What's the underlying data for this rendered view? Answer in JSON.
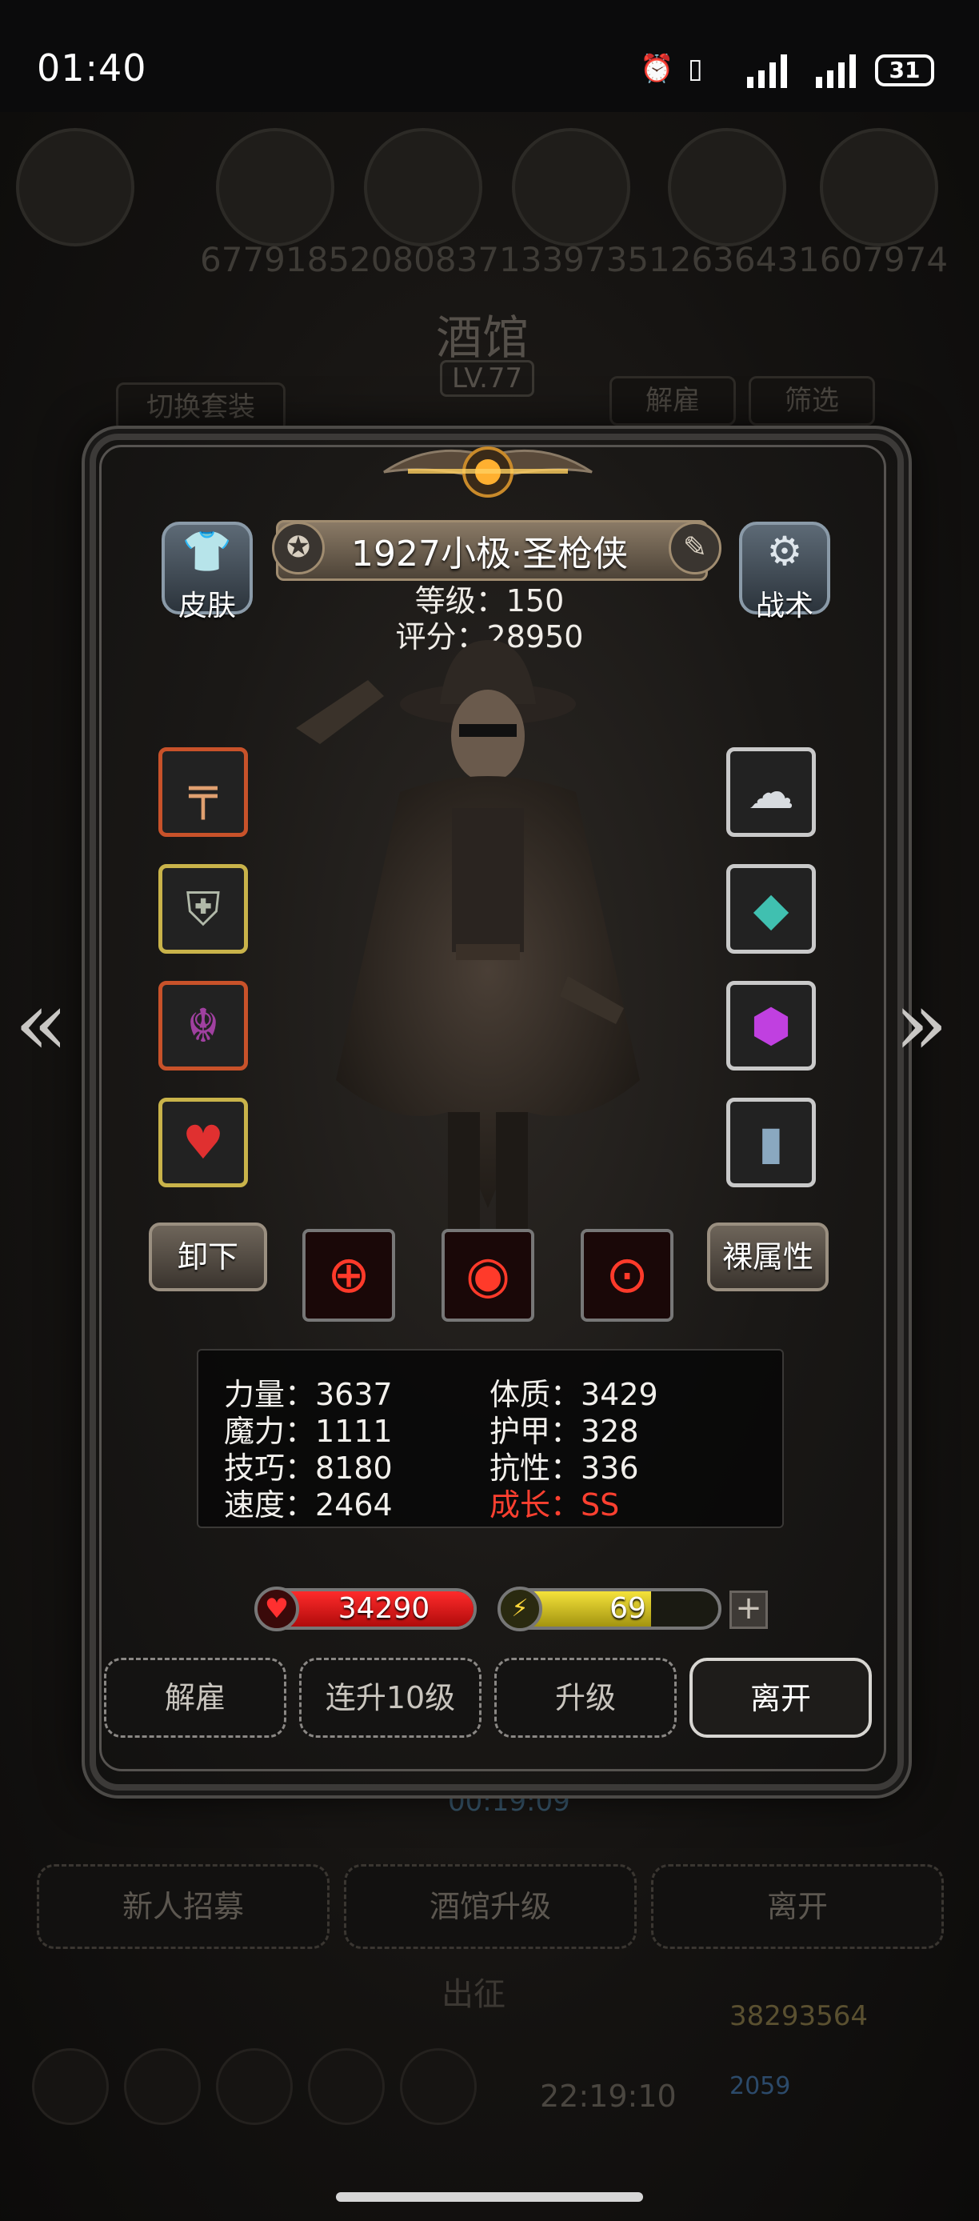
{
  "status_bar": {
    "time": "01:40",
    "battery": "31",
    "icons": [
      "alarm-icon",
      "vibrate-icon",
      "signal-icon",
      "signal-icon"
    ]
  },
  "background": {
    "resources": [
      "6779185",
      "2080837",
      "1339735",
      "1263643",
      "1607974"
    ],
    "title": "酒馆",
    "level": "LV.77",
    "switch_set_label": "切换套装",
    "dismiss_label": "解雇",
    "filter_label": "筛选",
    "timer": "00:19:09",
    "recruit_label": "新人招募",
    "upgrade_tavern_label": "酒馆升级",
    "leave_label": "离开",
    "expedition_label": "出征",
    "gold": "38293564",
    "gems": "2059",
    "time2": "22:19:10"
  },
  "hero": {
    "name": "1927小极·圣枪侠",
    "level_text": "等级：150",
    "score_text": "评分：28950",
    "skin_label": "皮肤",
    "tactics_label": "战术",
    "unequip_label": "卸下",
    "base_attr_label": "裸属性"
  },
  "equipment_left": [
    {
      "name": "flintlock-pistol-icon",
      "glyph": "╤",
      "frame": "#c8522a"
    },
    {
      "name": "chest-armor-icon",
      "glyph": "⛨",
      "frame": "#c9b34a"
    },
    {
      "name": "demon-helm-icon",
      "glyph": "☬",
      "frame": "#c8522a"
    },
    {
      "name": "heart-amulet-icon",
      "glyph": "♥",
      "frame": "#c9b34a"
    }
  ],
  "equipment_right": [
    {
      "name": "cloud-orb-icon",
      "glyph": "☁",
      "frame": "#c9c9c9"
    },
    {
      "name": "crystal-rune-icon",
      "glyph": "◆",
      "frame": "#c9c9c9"
    },
    {
      "name": "purple-gem-icon",
      "glyph": "⬢",
      "frame": "#c9c9c9"
    },
    {
      "name": "tome-icon",
      "glyph": "▮",
      "frame": "#c9c9c9"
    }
  ],
  "skills": [
    {
      "name": "crosshair-skill-icon",
      "glyph": "⊕"
    },
    {
      "name": "vortex-skill-icon",
      "glyph": "◉"
    },
    {
      "name": "target-skill-icon",
      "glyph": "⊙"
    }
  ],
  "stats": {
    "strength": "力量：3637",
    "constitution": "体质：3429",
    "magic": "魔力：1111",
    "armor": "护甲：328",
    "skill": "技巧：8180",
    "resistance": "抗性：336",
    "speed": "速度：2464",
    "growth": "成长：SS"
  },
  "bars": {
    "hp": "34290",
    "hp_fill": 1.0,
    "energy": "69",
    "energy_fill": 0.69,
    "plus": "+"
  },
  "actions": {
    "dismiss": "解雇",
    "upgrade10": "连升10级",
    "upgrade": "升级",
    "leave": "离开"
  },
  "colors": {
    "growth_red": "#ff4030",
    "hp_red": "#e01a1a",
    "energy_yellow": "#e6d224"
  }
}
